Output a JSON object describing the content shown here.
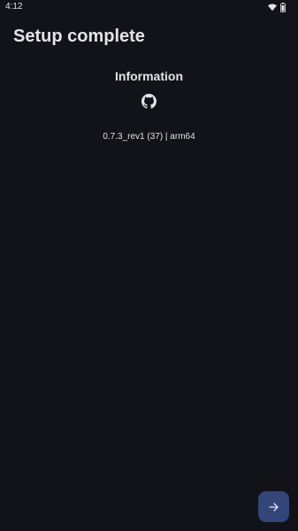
{
  "status_bar": {
    "time": "4:12",
    "wifi_icon": "wifi-icon",
    "battery_icon": "battery-icon"
  },
  "page": {
    "title": "Setup complete"
  },
  "information": {
    "heading": "Information",
    "github_icon": "github-icon",
    "version_text": "0.7.3_rev1 (37) | arm64"
  },
  "fab": {
    "icon": "arrow-forward-icon"
  },
  "colors": {
    "background": "#111318",
    "text": "#e3e2e9",
    "fab_background": "#334579"
  }
}
